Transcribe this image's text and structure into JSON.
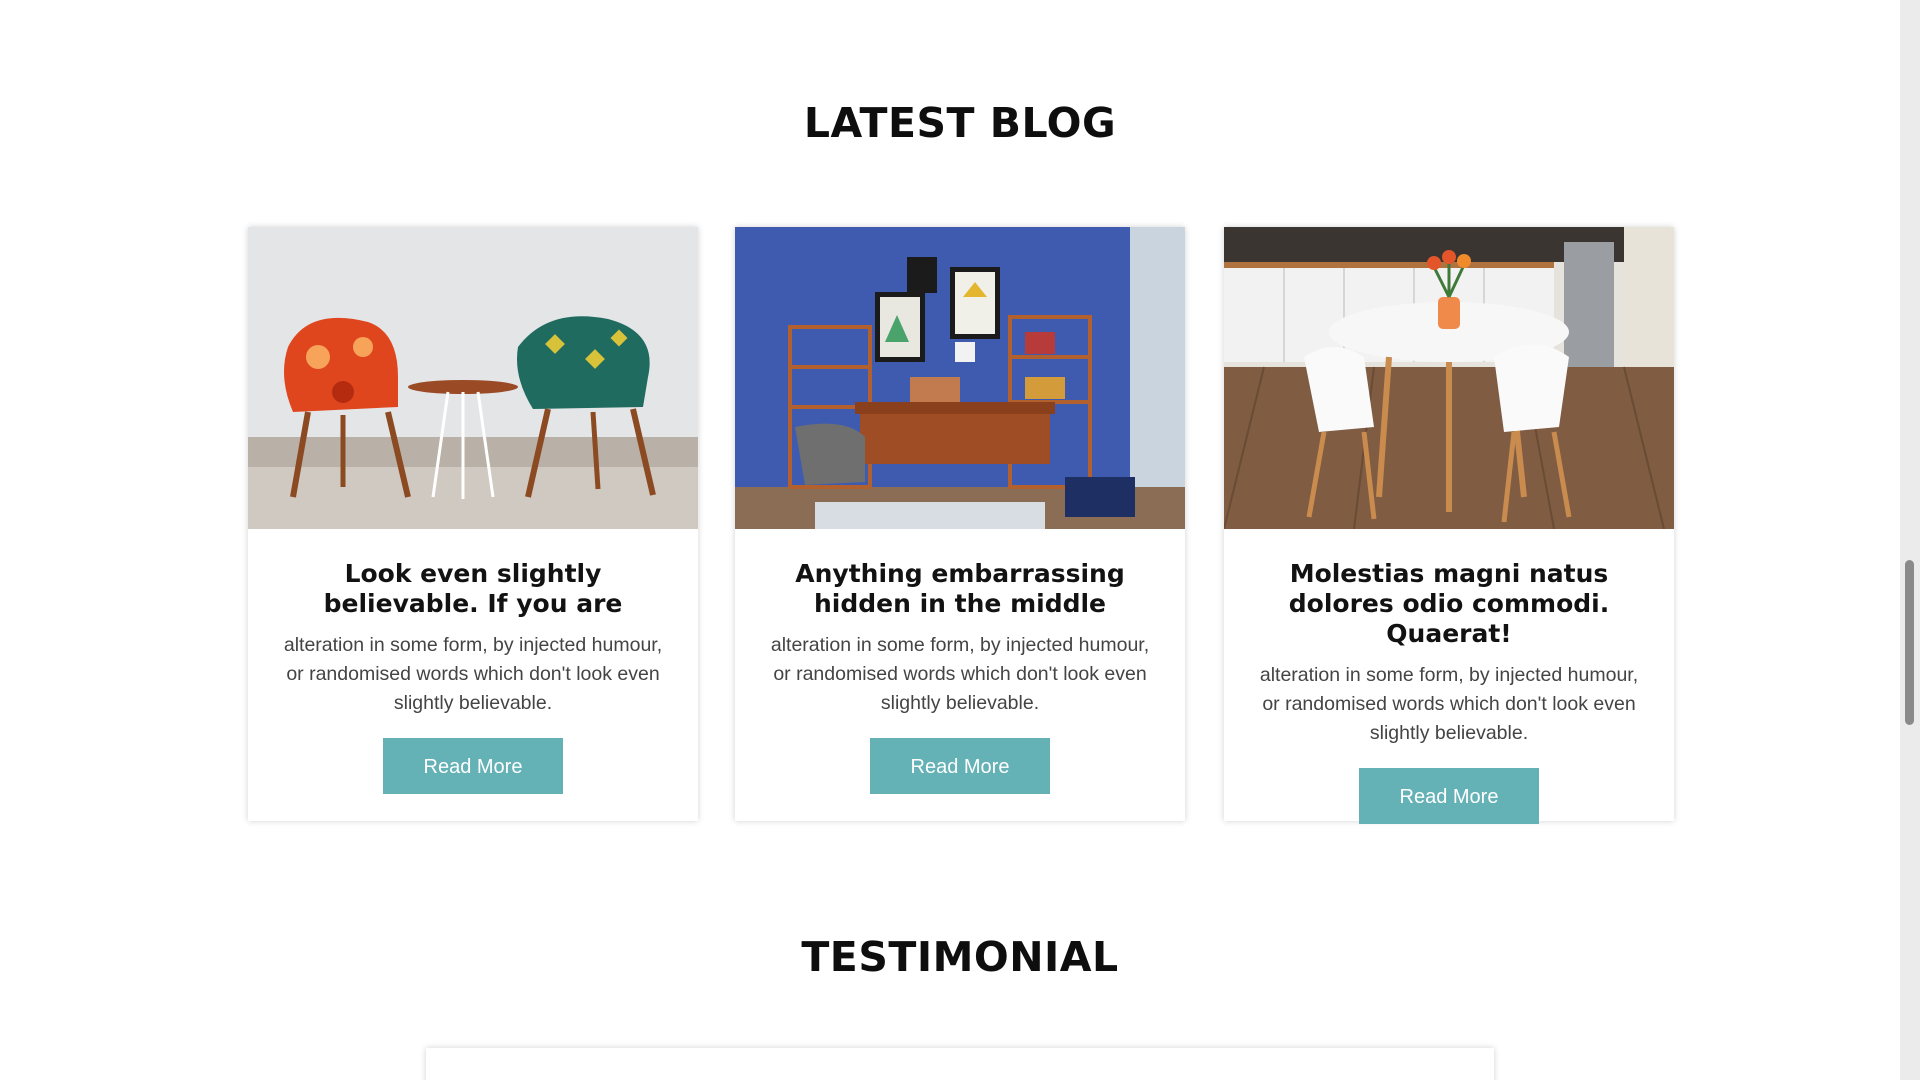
{
  "blog": {
    "title": "LATEST BLOG",
    "posts": [
      {
        "image": "chairs-photo",
        "title": "Look even slightly believable. If you are",
        "text": "alteration in some form, by injected humour, or randomised words which don't look even slightly believable.",
        "button_label": "Read More"
      },
      {
        "image": "blue-office-photo",
        "title": "Anything embarrassing hidden in the middle",
        "text": "alteration in some form, by injected humour, or randomised words which don't look even slightly believable.",
        "button_label": "Read More"
      },
      {
        "image": "dining-table-photo",
        "title": "Molestias magni natus dolores odio commodi. Quaerat!",
        "text": "alteration in some form, by injected humour, or randomised words which don't look even slightly believable.",
        "button_label": "Read More"
      }
    ]
  },
  "testimonial": {
    "title": "TESTIMONIAL"
  },
  "colors": {
    "accent": "#64b1b6",
    "heading": "#0e0e0e",
    "body_text": "#444444"
  }
}
